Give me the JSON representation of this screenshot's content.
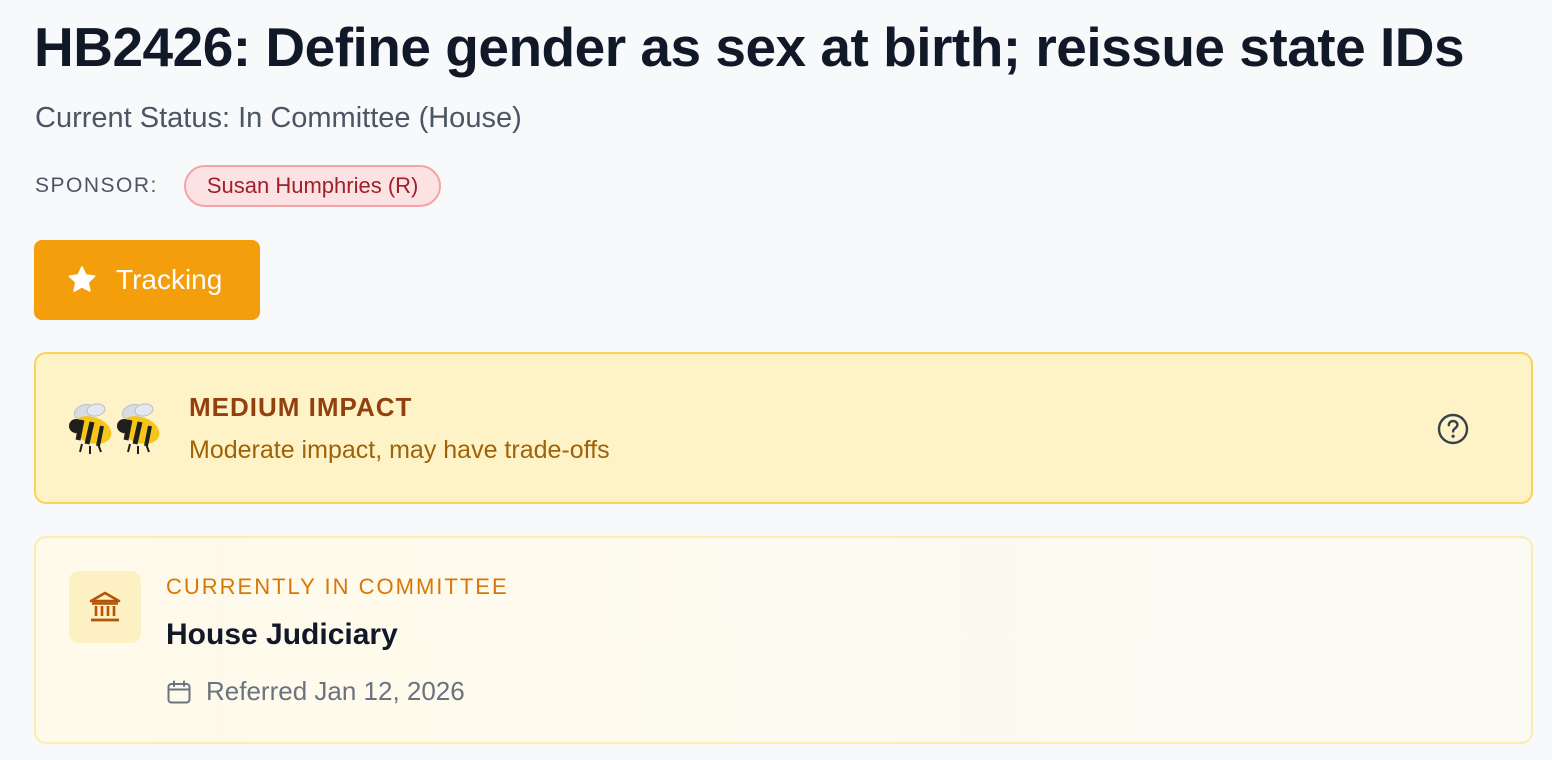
{
  "bill": {
    "title": "HB2426: Define gender as sex at birth; reissue state IDs",
    "status": "Current Status: In Committee (House)"
  },
  "sponsor": {
    "label": "SPONSOR:",
    "name": "Susan Humphries (R)"
  },
  "tracking": {
    "label": "Tracking",
    "icon": "star-icon",
    "color": "#f59e0b"
  },
  "impact": {
    "title": "MEDIUM IMPACT",
    "description": "Moderate impact, may have trade-offs",
    "bee_count": 2,
    "icon": "bee-icon",
    "help_icon": "help-circle-icon",
    "accent": "#92400e",
    "background": "#fef3c7"
  },
  "committee": {
    "label": "CURRENTLY IN COMMITTEE",
    "name": "House Judiciary",
    "referred": "Referred Jan 12, 2026",
    "icon": "building-columns-icon",
    "date_icon": "calendar-icon",
    "accent": "#d97706"
  }
}
